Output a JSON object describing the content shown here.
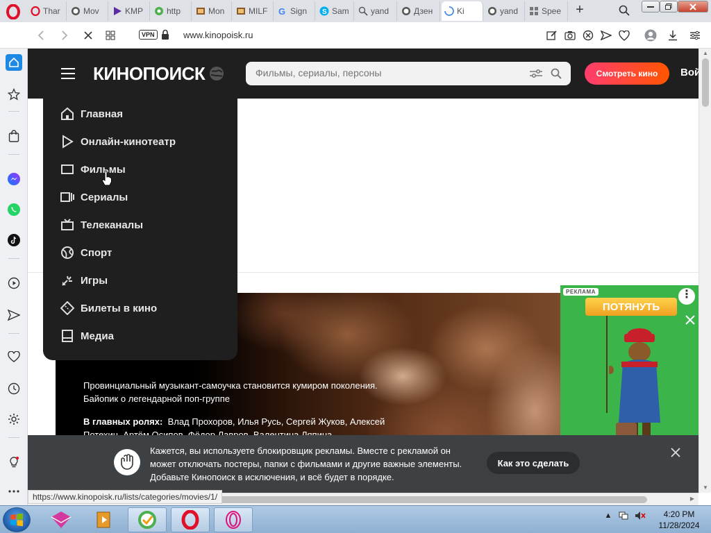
{
  "browser": {
    "tabs": [
      {
        "label": "Thar",
        "icon": "opera-o-icon"
      },
      {
        "label": "Mov",
        "icon": "world-icon"
      },
      {
        "label": "KMP",
        "icon": "play-icon"
      },
      {
        "label": "http",
        "icon": "leaf-icon"
      },
      {
        "label": "Mon",
        "icon": "page-icon"
      },
      {
        "label": "MILF",
        "icon": "page-icon"
      },
      {
        "label": "Sign",
        "icon": "google-icon"
      },
      {
        "label": "Sam",
        "icon": "skype-icon"
      },
      {
        "label": "yand",
        "icon": "search-icon"
      },
      {
        "label": "Дзен",
        "icon": "world-icon"
      },
      {
        "label": "Ki",
        "icon": "loading-icon",
        "active": true
      },
      {
        "label": "yand",
        "icon": "world-icon"
      },
      {
        "label": "Spee",
        "icon": "grid-icon"
      }
    ],
    "vpn_label": "VPN",
    "url": "www.kinopoisk.ru",
    "status_url": "https://www.kinopoisk.ru/lists/categories/movies/1/"
  },
  "site": {
    "logo_text": "КИНОПОИСК",
    "search_placeholder": "Фильмы, сериалы, персоны",
    "watch_button": "Смотреть кино",
    "login_label": "Вой",
    "accent_color": "#ff3d6e"
  },
  "menu": {
    "items": [
      {
        "label": "Главная",
        "icon": "home-icon"
      },
      {
        "label": "Онлайн-кинотеатр",
        "icon": "play-icon"
      },
      {
        "label": "Фильмы",
        "icon": "screen-icon"
      },
      {
        "label": "Сериалы",
        "icon": "series-icon"
      },
      {
        "label": "Телеканалы",
        "icon": "tv-icon"
      },
      {
        "label": "Спорт",
        "icon": "ball-icon"
      },
      {
        "label": "Игры",
        "icon": "games-icon"
      },
      {
        "label": "Билеты в кино",
        "icon": "ticket-icon"
      },
      {
        "label": "Медиа",
        "icon": "media-icon"
      }
    ]
  },
  "hero": {
    "description": "Провинциальный музыкант-самоучка становится кумиром поколения. Байопик о легендарной поп-группе",
    "cast_label": "В главных ролях:",
    "cast_names": "Влад Прохоров, Илья Русь, Сергей Жуков, Алексей Потехин, Артём Осипов, Фёдор Лавров, Валентина Ляпина"
  },
  "ad": {
    "badge": "РЕКЛАМА",
    "button": "ПОТЯНУТЬ",
    "bg_color": "#3bb54a"
  },
  "adblock": {
    "message": "Кажется, вы используете блокировщик рекламы. Вместе с рекламой он может отключать постеры, папки с фильмами и другие важные элементы. Добавьте Кинопоиск в исключения, и всё будет в порядке.",
    "button": "Как это сделать"
  },
  "taskbar": {
    "time": "4:20 PM",
    "date": "11/28/2024"
  }
}
